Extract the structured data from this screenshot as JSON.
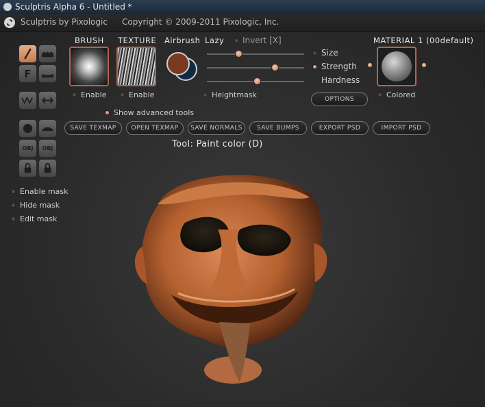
{
  "window": {
    "title": "Sculptris Alpha 6 - Untitled *"
  },
  "app": {
    "name": "Sculptris by Pixologic",
    "copyright": "Copyright © 2009-2011 Pixologic, Inc."
  },
  "brush": {
    "header": "BRUSH",
    "enable_label": "Enable"
  },
  "texture": {
    "header": "TEXTURE",
    "enable_label": "Enable"
  },
  "airbrush": {
    "label": "Airbrush",
    "color_front": "#7a3a22",
    "color_back": "#0f2a44"
  },
  "lazy": {
    "label": "Lazy"
  },
  "invert": {
    "label": "Invert [X]"
  },
  "sliders": [
    {
      "label": "Size",
      "value": 0.33
    },
    {
      "label": "Strength",
      "value": 0.7
    },
    {
      "label": "Hardness",
      "value": 0.52
    }
  ],
  "heightmask": {
    "label": "Heightmask"
  },
  "material": {
    "header": "MATERIAL 1 (00default)",
    "colored_label": "Colored"
  },
  "options_button": "OPTIONS",
  "advanced": {
    "label": "Show advanced tools"
  },
  "action_buttons": [
    "SAVE TEXMAP",
    "OPEN TEXMAP",
    "SAVE NORMALS",
    "SAVE BUMPS",
    "EXPORT PSD",
    "IMPORT PSD"
  ],
  "tool_status": "Tool: Paint color (D)",
  "left_tools": {
    "paint": "paint-brush-icon",
    "bumps": "bump-icon",
    "flatten": "F",
    "smooth": "smooth-icon",
    "mirror": "wave-icon",
    "swap": "swap-arrows-icon",
    "sphere": "sphere-icon",
    "plane": "plane-icon",
    "import_obj": "OBJ",
    "export_obj": "OBJ"
  },
  "mask": [
    {
      "label": "Enable mask"
    },
    {
      "label": "Hide mask"
    },
    {
      "label": "Edit mask"
    }
  ]
}
